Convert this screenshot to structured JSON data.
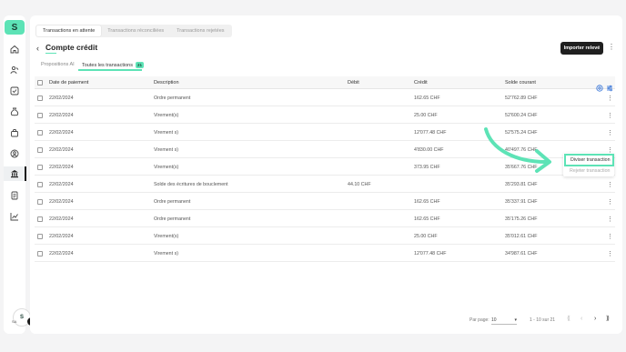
{
  "top_tabs": [
    "Transactions en attente",
    "Transactions réconciliées",
    "Transactions rejetées"
  ],
  "page_title": "Compte crédit",
  "import_button": "Importer relevé",
  "sub_tabs": {
    "ai": "Propositions AI",
    "all": "Toutes les transactions",
    "all_count": "21"
  },
  "columns": {
    "date": "Date de paiement",
    "description": "Description",
    "debit": "Débit",
    "credit": "Crédit",
    "balance": "Solde courant"
  },
  "rows": [
    {
      "date": "22/02/2024",
      "description": "Ordre permanent",
      "debit": "",
      "credit": "162.65 CHF",
      "balance": "52'762.89 CHF"
    },
    {
      "date": "22/02/2024",
      "description": "Virement(s)",
      "debit": "",
      "credit": "25.00 CHF",
      "balance": "52'600.24 CHF"
    },
    {
      "date": "22/02/2024",
      "description": "Virement s)",
      "debit": "",
      "credit": "12'077.48 CHF",
      "balance": "52'575.24 CHF"
    },
    {
      "date": "22/02/2024",
      "description": "Virement s)",
      "debit": "",
      "credit": "4'830.00 CHF",
      "balance": "40'497.76 CHF"
    },
    {
      "date": "22/02/2024",
      "description": "Virement(s)",
      "debit": "",
      "credit": "373.95 CHF",
      "balance": "35'667.76 CHF"
    },
    {
      "date": "22/02/2024",
      "description": "Solde des écritures de bouclement",
      "debit": "44.10 CHF",
      "credit": "",
      "balance": "35'293.81 CHF"
    },
    {
      "date": "22/02/2024",
      "description": "Ordre permanent",
      "debit": "",
      "credit": "162.65 CHF",
      "balance": "35'337.91 CHF"
    },
    {
      "date": "22/02/2024",
      "description": "Ordre permanent",
      "debit": "",
      "credit": "162.65 CHF",
      "balance": "35'175.26 CHF"
    },
    {
      "date": "22/02/2024",
      "description": "Virement(s)",
      "debit": "",
      "credit": "25.00 CHF",
      "balance": "35'012.61 CHF"
    },
    {
      "date": "22/02/2024",
      "description": "Virement s)",
      "debit": "",
      "credit": "12'077.48 CHF",
      "balance": "34'987.61 CHF"
    }
  ],
  "context_menu": {
    "split": "Diviser transaction",
    "reject": "Rejeter transaction"
  },
  "footer": {
    "per_page_label": "Par page:",
    "per_page_value": "10",
    "range": "1 - 10 sur 21"
  },
  "logo_text": "S",
  "avatar_text": "S",
  "avatar_sub": "SA",
  "avatar_badge": "1",
  "colors": {
    "accent": "#5de3b6",
    "primary_button": "#1f1f1f",
    "icon_blue": "#2f6fd6"
  },
  "icons": {
    "nav": [
      "home-icon",
      "people-icon",
      "check-icon",
      "money-bag-icon",
      "bag-icon",
      "user-circle-icon",
      "bank-icon",
      "document-icon",
      "chart-icon"
    ],
    "header": [
      "settings-icon",
      "filter-icon"
    ]
  }
}
